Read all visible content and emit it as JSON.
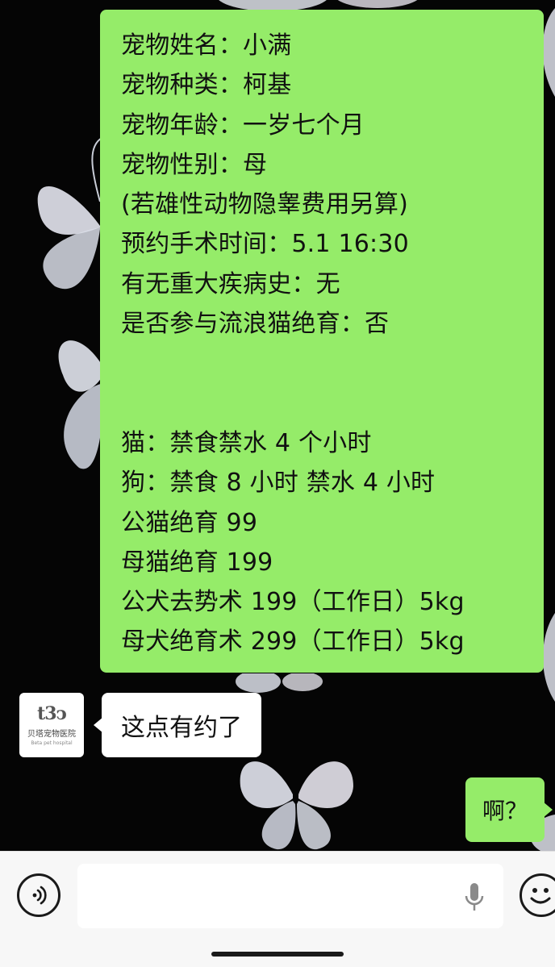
{
  "messages": {
    "main": {
      "lines": [
        "宠物姓名：小满",
        "宠物种类：柯基",
        "宠物年龄：一岁七个月",
        "宠物性别：母",
        "(若雄性动物隐睾费用另算)",
        "预约手术时间：5.1  16:30",
        "有无重大疾病史：无",
        "是否参与流浪猫绝育：否"
      ],
      "lines_after_gap": [
        "猫：禁食禁水 4 个小时",
        "狗：禁食 8 小时 禁水 4 小时",
        "公猫绝育 99",
        "母猫绝育 199",
        "公犬去势术 199（工作日）5kg",
        "母犬绝育术 299（工作日）5kg"
      ]
    },
    "reply": "这点有约了",
    "self": "啊？"
  },
  "avatar": {
    "logo_mark": "t3ↄ",
    "name": "贝塔宠物医院",
    "name_en": "Beta pet hospital"
  },
  "input": {
    "value": "",
    "placeholder": ""
  },
  "icons": {
    "voice": "voice-wave-icon",
    "mic": "microphone-icon",
    "emoji": "emoji-smile-icon"
  },
  "colors": {
    "self_bubble": "#95ec69",
    "other_bubble": "#ffffff",
    "chat_background": "#050505",
    "input_bar": "#f7f7f7"
  }
}
